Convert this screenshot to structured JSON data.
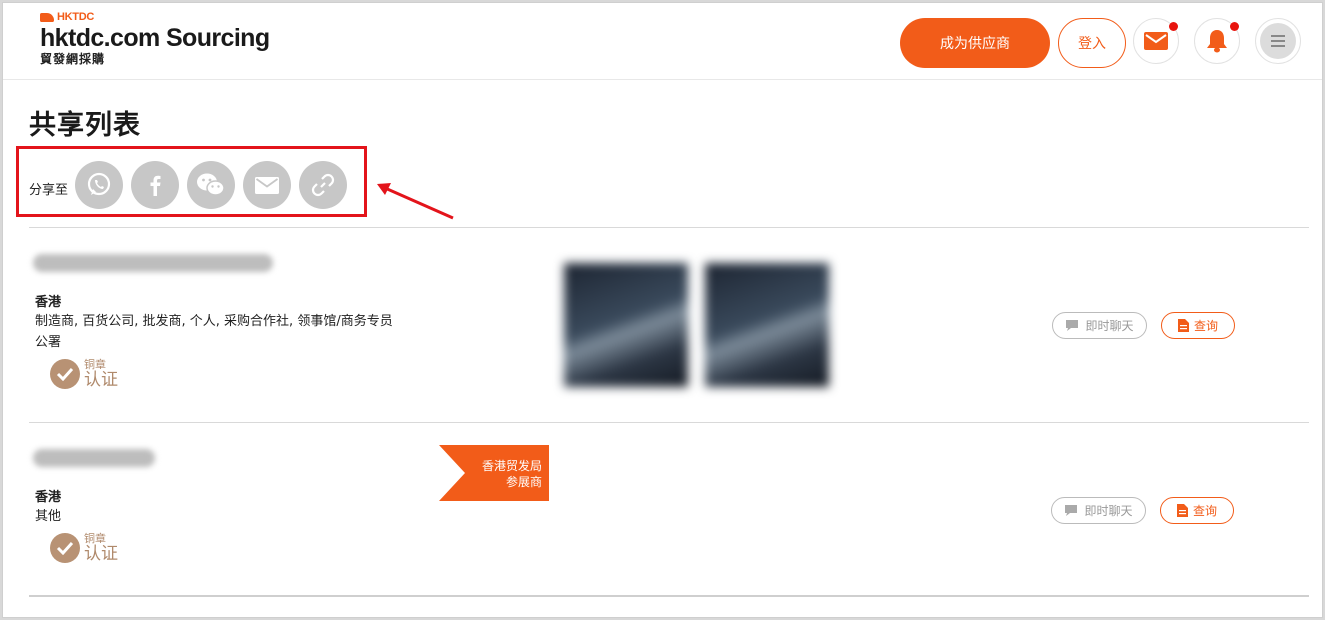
{
  "header": {
    "logo_mark": "HKTDC",
    "logo_name": "hktdc.com Sourcing",
    "logo_sub": "貿發網採購",
    "supplier_button": "成为供应商",
    "login_button": "登入"
  },
  "page": {
    "title": "共享列表"
  },
  "share": {
    "label": "分享至",
    "channels": [
      "whatsapp-icon",
      "facebook-icon",
      "wechat-icon",
      "email-icon",
      "link-icon"
    ]
  },
  "results": [
    {
      "region": "香港",
      "business_types": "制造商, 百货公司, 批发商, 个人, 采购合作社, 领事馆/商务专员公署",
      "badge_top": "铜章",
      "badge_bottom": "认证",
      "chat_label": "即时聊天",
      "inquiry_label": "查询"
    },
    {
      "region": "香港",
      "business_types": "其他",
      "badge_top": "铜章",
      "badge_bottom": "认证",
      "exhibitor_line1": "香港贸发局",
      "exhibitor_line2": "参展商",
      "chat_label": "即时聊天",
      "inquiry_label": "查询"
    }
  ],
  "colors": {
    "brand_orange": "#f25c19",
    "highlight_red": "#e3141b",
    "badge_bronze": "#b08a6c"
  }
}
